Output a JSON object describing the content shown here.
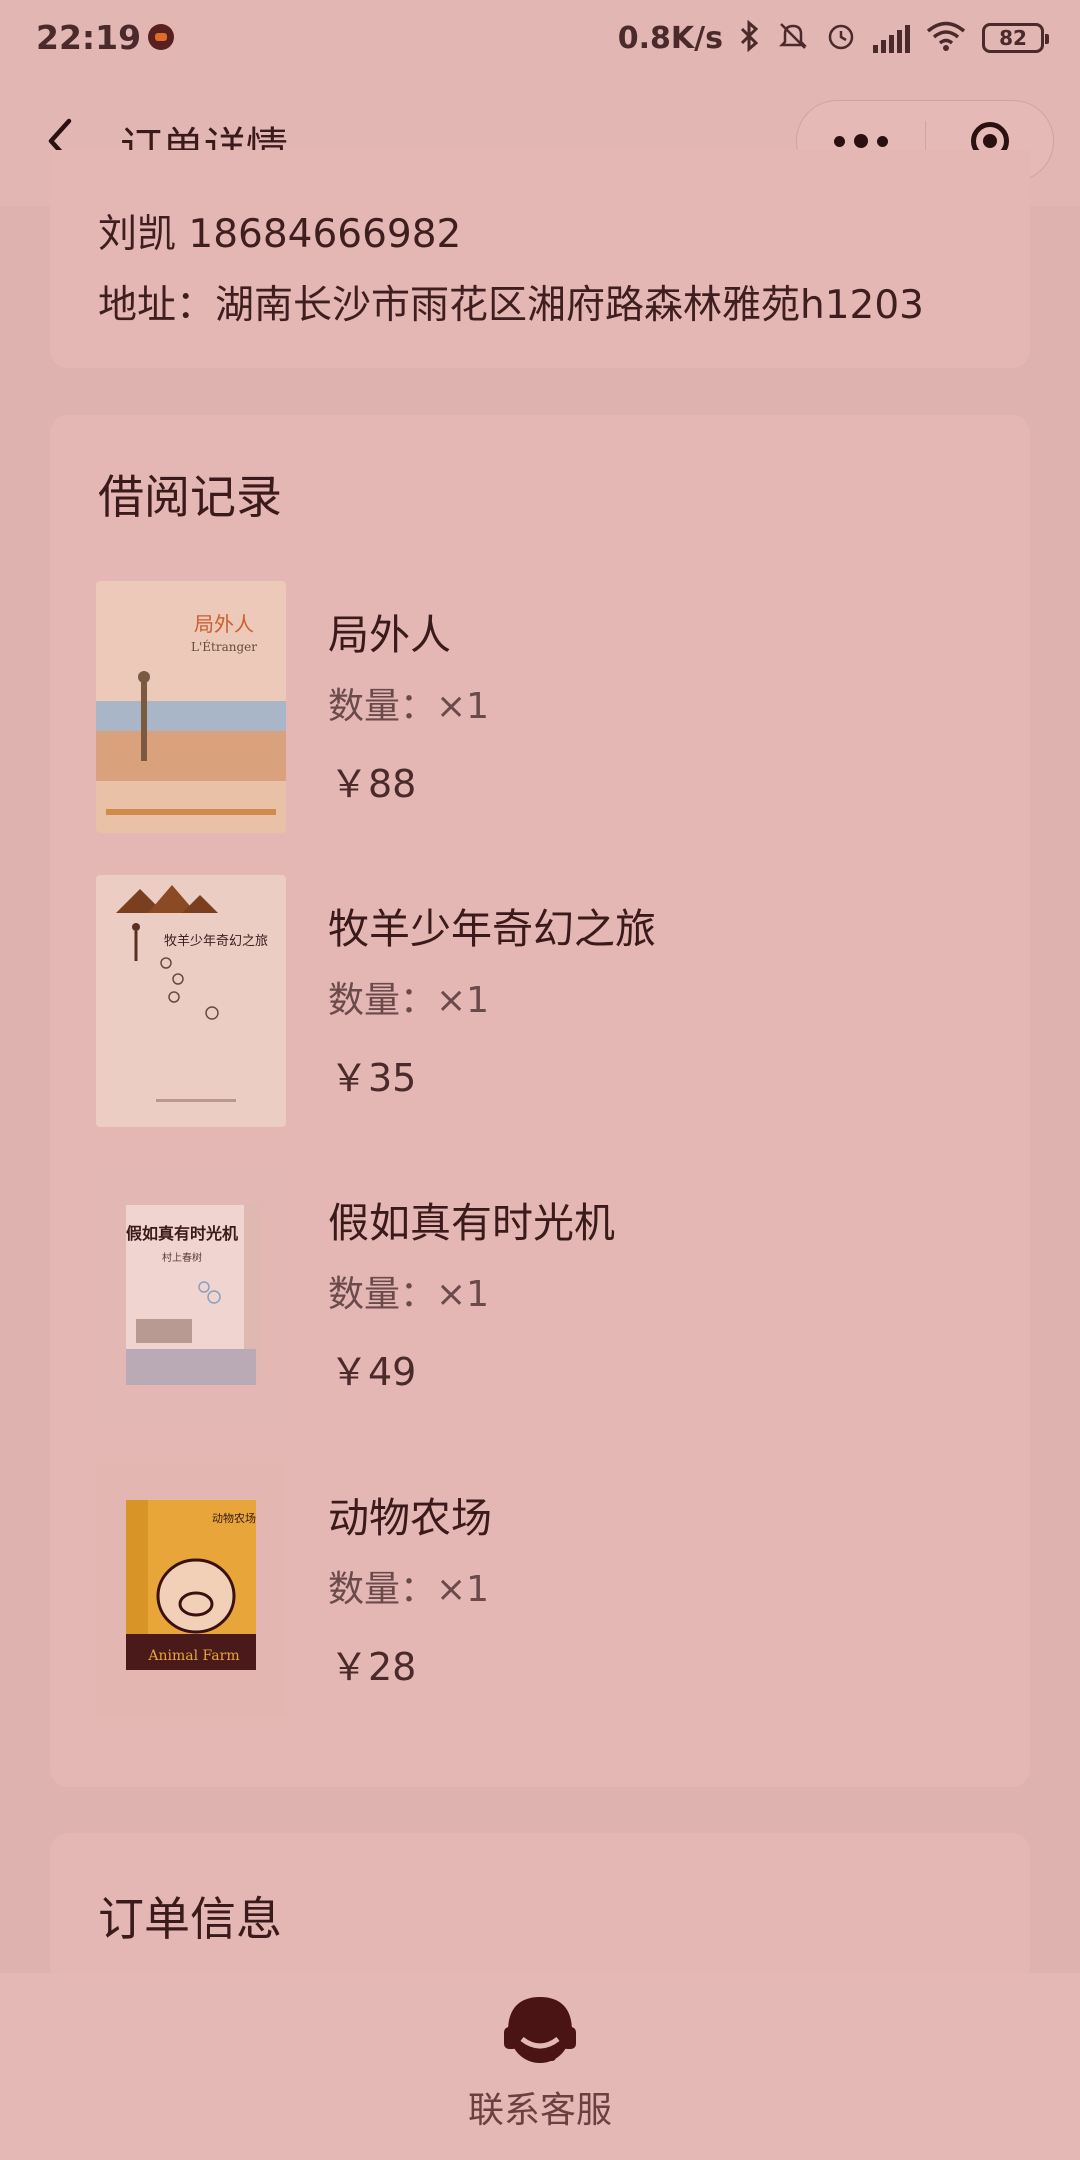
{
  "status_bar": {
    "time": "22:19",
    "net_speed": "0.8K/s",
    "battery": "82"
  },
  "nav": {
    "title": "订单详情"
  },
  "address": {
    "contact": "刘凯 18684666982",
    "address": "地址：湖南长沙市雨花区湘府路森林雅苑h1203"
  },
  "records": {
    "title": "借阅记录",
    "books": [
      {
        "name": "局外人",
        "quantity": "数量：×1",
        "price": "￥88",
        "cover_title": "局外人",
        "cover_subtitle": "L'Étranger"
      },
      {
        "name": "牧羊少年奇幻之旅",
        "quantity": "数量：×1",
        "price": "￥35",
        "cover_title": "牧羊少年奇幻之旅"
      },
      {
        "name": "假如真有时光机",
        "quantity": "数量：×1",
        "price": "￥49",
        "cover_title": "假如真有时光机",
        "cover_author": "村上春树"
      },
      {
        "name": "动物农场",
        "quantity": "数量：×1",
        "price": "￥28",
        "cover_title": "动物农场",
        "cover_subtitle": "Animal Farm"
      }
    ]
  },
  "order_info": {
    "title": "订单信息"
  },
  "bottom": {
    "service_label": "联系客服"
  },
  "colors": {
    "background": "#ddb2af",
    "card": "#e5b7b4",
    "text": "#3a1a1a"
  }
}
